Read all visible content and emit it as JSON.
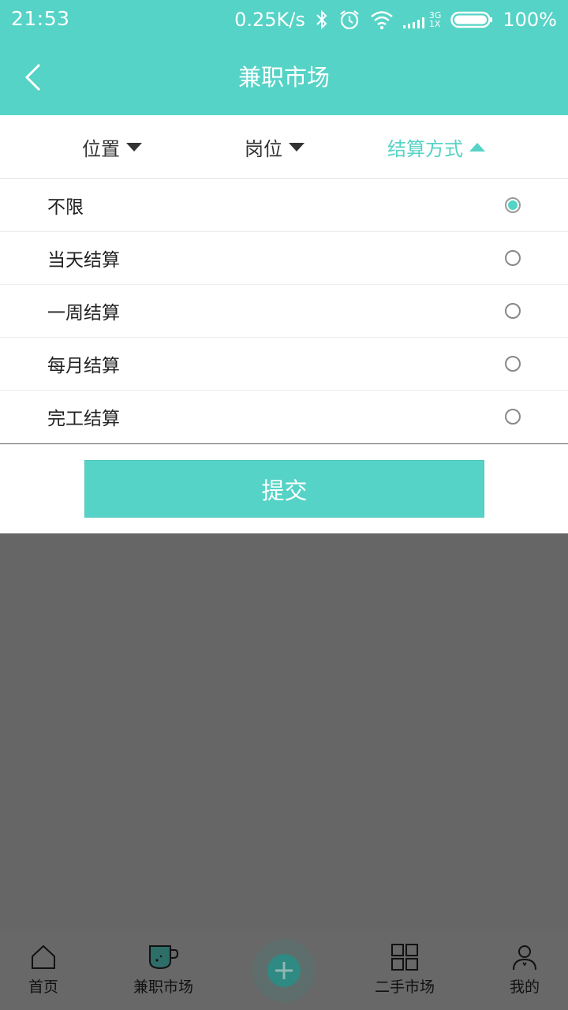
{
  "status_bar": {
    "time": "21:53",
    "net_speed": "0.25K/s",
    "signal_top": "3G",
    "signal_bottom": "1X",
    "battery": "100%"
  },
  "header": {
    "title": "兼职市场",
    "back_icon": "chevron-left-icon"
  },
  "filters": {
    "tabs": [
      {
        "label": "位置",
        "state": "collapsed"
      },
      {
        "label": "岗位",
        "state": "collapsed"
      },
      {
        "label": "结算方式",
        "state": "expanded"
      }
    ]
  },
  "settlement_options": [
    {
      "label": "不限",
      "selected": true
    },
    {
      "label": "当天结算",
      "selected": false
    },
    {
      "label": "一周结算",
      "selected": false
    },
    {
      "label": "每月结算",
      "selected": false
    },
    {
      "label": "完工结算",
      "selected": false
    }
  ],
  "submit_label": "提交",
  "bottom_nav": {
    "items": [
      {
        "label": "首页",
        "icon": "home-icon"
      },
      {
        "label": "兼职市场",
        "icon": "cup-icon"
      },
      {
        "label": "",
        "icon": "plus-icon"
      },
      {
        "label": "二手市场",
        "icon": "grid-icon"
      },
      {
        "label": "我的",
        "icon": "user-icon"
      }
    ]
  },
  "colors": {
    "accent": "#55d3c6",
    "overlay": "#666666"
  }
}
